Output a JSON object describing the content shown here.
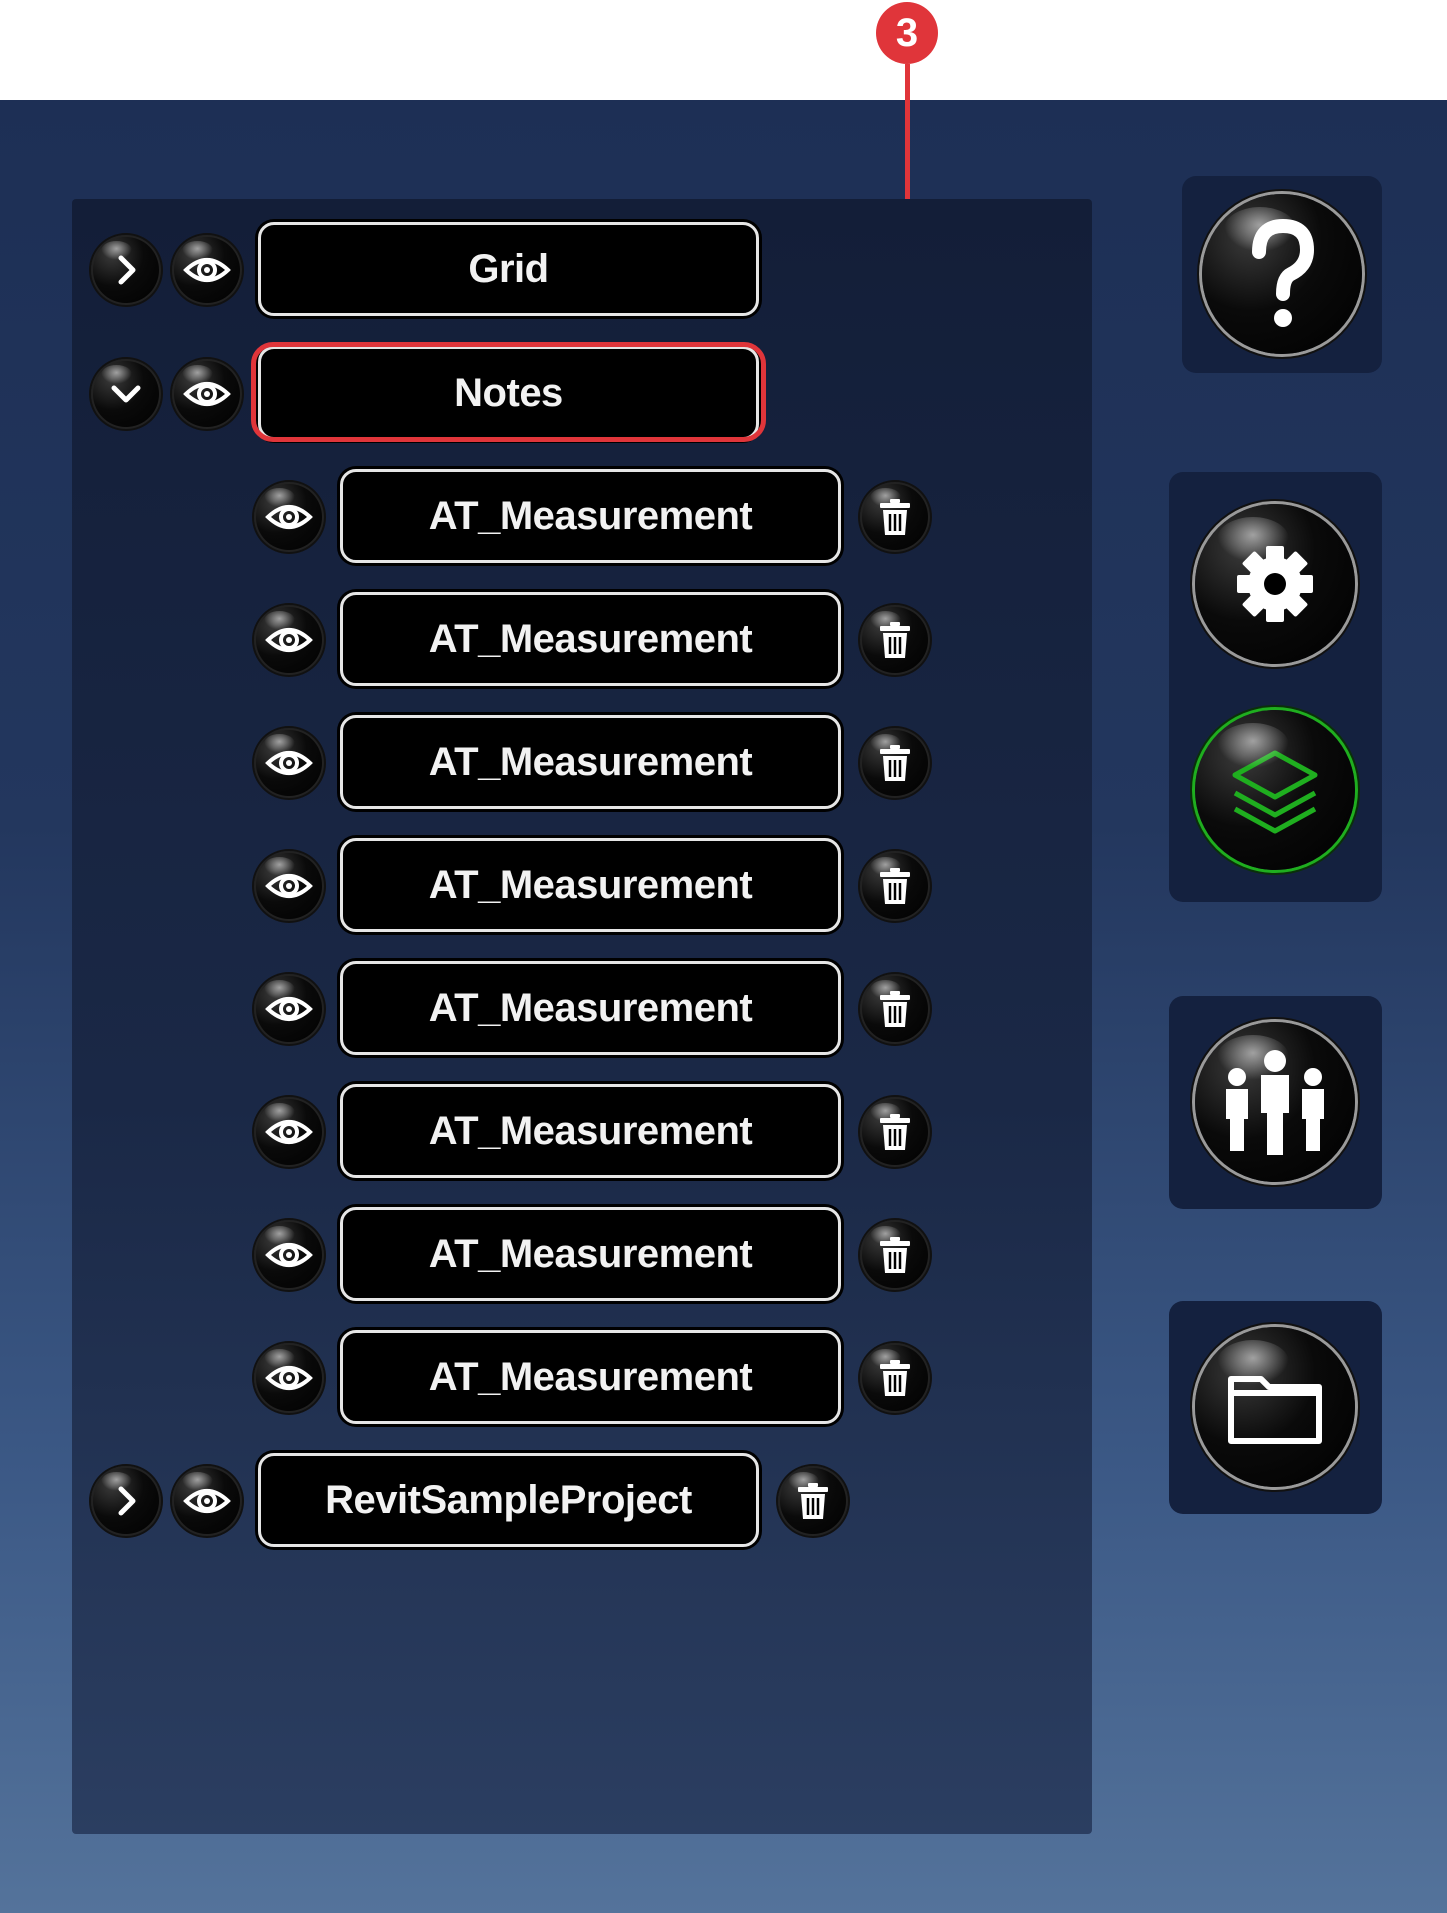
{
  "callout": {
    "number": "3"
  },
  "layers": [
    {
      "label": "Grid",
      "expander": "chevron-right-icon"
    },
    {
      "label": "Notes",
      "expander": "chevron-down-icon"
    },
    {
      "label": "AT_Measurement"
    },
    {
      "label": "AT_Measurement"
    },
    {
      "label": "AT_Measurement"
    },
    {
      "label": "AT_Measurement"
    },
    {
      "label": "AT_Measurement"
    },
    {
      "label": "AT_Measurement"
    },
    {
      "label": "AT_Measurement"
    },
    {
      "label": "AT_Measurement"
    },
    {
      "label": "RevitSampleProject",
      "expander": "chevron-right-icon"
    }
  ],
  "toolbar": {
    "help": "question-mark-icon",
    "settings": "gear-icon",
    "layers": "layers-icon",
    "users": "users-icon",
    "folder": "folder-icon",
    "active_color": "#1fae1f"
  },
  "colors": {
    "callout": "#e0353a"
  }
}
